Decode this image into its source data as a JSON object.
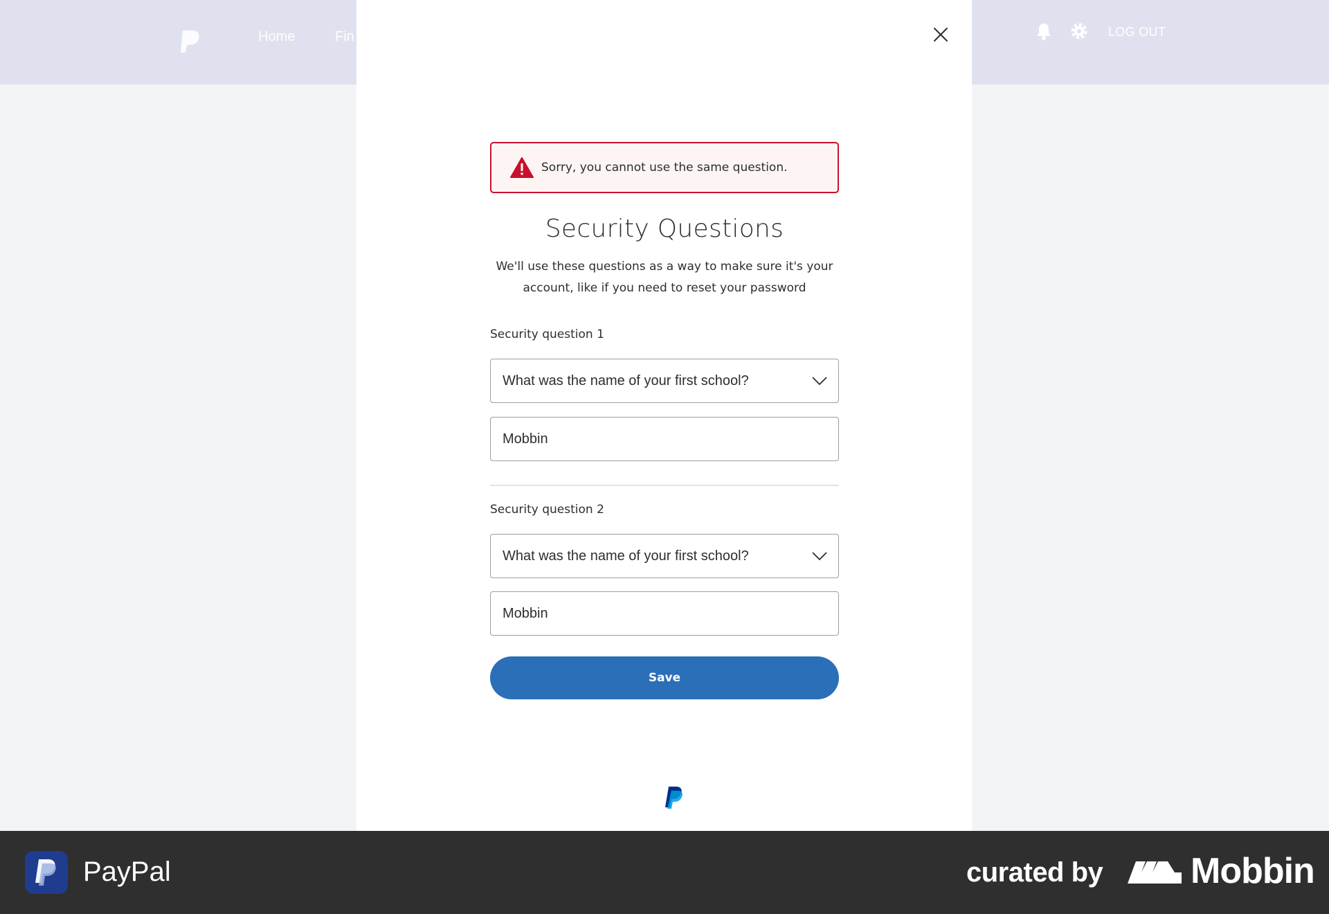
{
  "background": {
    "nav_home": "Home",
    "nav_find": "Fin",
    "logout": "LOG OUT"
  },
  "alert": {
    "message": "Sorry, you cannot use the same question.",
    "icon": "warning-triangle-icon",
    "color": "#c8102e"
  },
  "form": {
    "title": "Security Questions",
    "subtitle_line1": "We'll use these questions as a way to make sure it's your",
    "subtitle_line2": "account, like if you need to reset your password",
    "question1": {
      "label": "Security question 1",
      "selected": "What was the name of your first school?",
      "answer": "Mobbin"
    },
    "question2": {
      "label": "Security question 2",
      "selected": "What was the name of your first school?",
      "answer": "Mobbin"
    },
    "save_label": "Save",
    "accent_color": "#2a6fb7"
  },
  "branding": {
    "app_name": "PayPal",
    "curated_by": "curated by",
    "mobbin": "Mobbin"
  }
}
